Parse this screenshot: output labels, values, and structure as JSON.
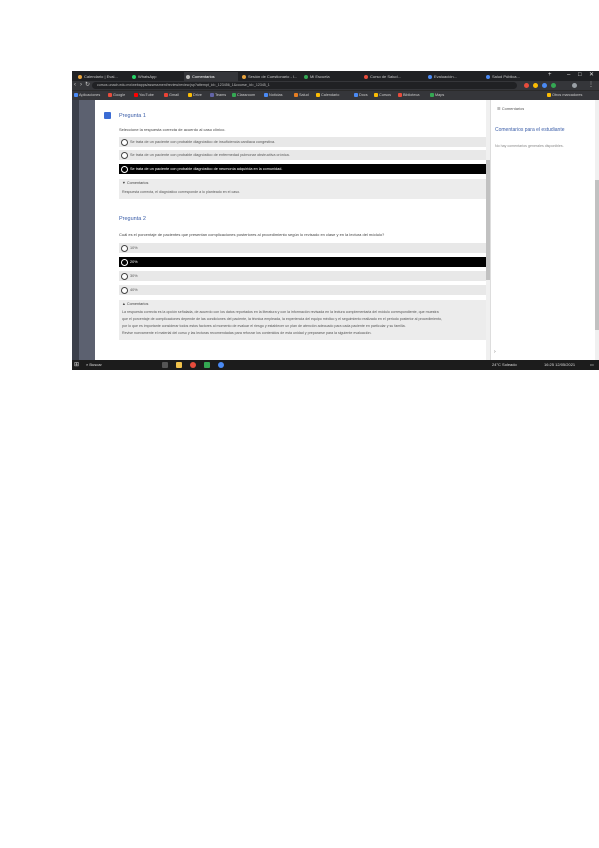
{
  "browser": {
    "tabs": [
      "Calendario | Eval...",
      "WhatsApp",
      "Comentarios",
      "Sesión de Cuestionario - I...",
      "Mi Escuela",
      "Curso de Salud...",
      "Evaluación...",
      "Salud Pública..."
    ],
    "url": "cursos.unach.edu.mx/webapps/assessment/review/review.jsp?attempt_id=_123456_1&course_id=_12345_1",
    "bookmarks": [
      "Aplicaciones",
      "Google",
      "YouTube",
      "Gmail",
      "Drive",
      "Teams",
      "Classroom",
      "Noticias",
      "Salud",
      "Calendario",
      "Docs",
      "Cursos",
      "Biblioteca",
      "Maps",
      "Otros marcadores"
    ]
  },
  "question1": {
    "title": "Pregunta 1",
    "prompt": "Seleccione la respuesta correcta de acuerdo al caso clínico.",
    "options": [
      "Se trata de un paciente con probable diagnóstico de insuficiencia cardiaca congestiva.",
      "Se trata de un paciente con probable diagnóstico de enfermedad pulmonar obstructiva crónica.",
      "Se trata de un paciente con probable diagnóstico de neumonía adquirida en la comunidad."
    ],
    "selected_index": 2,
    "feedback_title": "Comentarios",
    "feedback_text": "Respuesta correcta, el diagnóstico corresponde a lo planteado en el caso."
  },
  "question2": {
    "title": "Pregunta 2",
    "prompt": "Cuál es el porcentaje de pacientes que presentan complicaciones posteriores al procedimiento según lo revisado en clase y en la lectura del módulo?",
    "options": [
      "10%",
      "20%",
      "30%",
      "40%"
    ],
    "selected_index": 1,
    "feedback_title": "Comentarios",
    "feedback_lines": [
      "La respuesta correcta es la opción señalada, de acuerdo con los datos reportados en la literatura y con la información revisada en la lectura complementaria del módulo correspondiente, que muestra",
      "que el porcentaje de complicaciones depende de las condiciones del paciente, la técnica empleada, la experiencia del equipo médico y el seguimiento realizado en el periodo posterior al procedimiento,",
      "por lo que es importante considerar todos estos factores al momento de evaluar el riesgo y establecer un plan de atención adecuado para cada paciente en particular y su familia.",
      "Revise nuevamente el material del curso y las lecturas recomendadas para reforzar los contenidos de esta unidad y prepararse para la siguiente evaluación."
    ]
  },
  "side_panel": {
    "header": "Comentarios",
    "title": "Comentarios para el estudiante",
    "subtitle": "No hay comentarios generales disponibles."
  },
  "taskbar": {
    "search": "Buscar",
    "tray": "24°C  Soleado",
    "time": "16:25",
    "date": "12/05/2021"
  },
  "colors": {
    "title_blue": "#3a5da8",
    "selected_option": "#000000",
    "option_bg": "#e8e8e8",
    "marker_blue": "#3b6cd4"
  }
}
